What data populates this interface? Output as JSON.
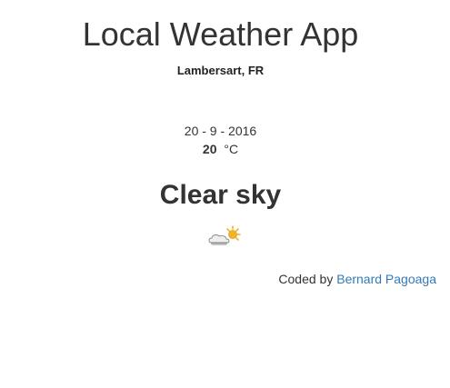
{
  "app": {
    "title": "Local Weather App",
    "location": "Lambersart, FR"
  },
  "weather": {
    "date": "20 - 9 - 2016",
    "temperature": "20",
    "unit": "°C",
    "condition": "Clear sky",
    "icon": "partly-cloudy-icon"
  },
  "footer": {
    "credit_prefix": "Coded by",
    "author": "Bernard Pagoaga"
  },
  "colors": {
    "text": "#333333",
    "link": "#337ab7",
    "sun": "#f5b323",
    "cloud": "#e8e8e8"
  }
}
